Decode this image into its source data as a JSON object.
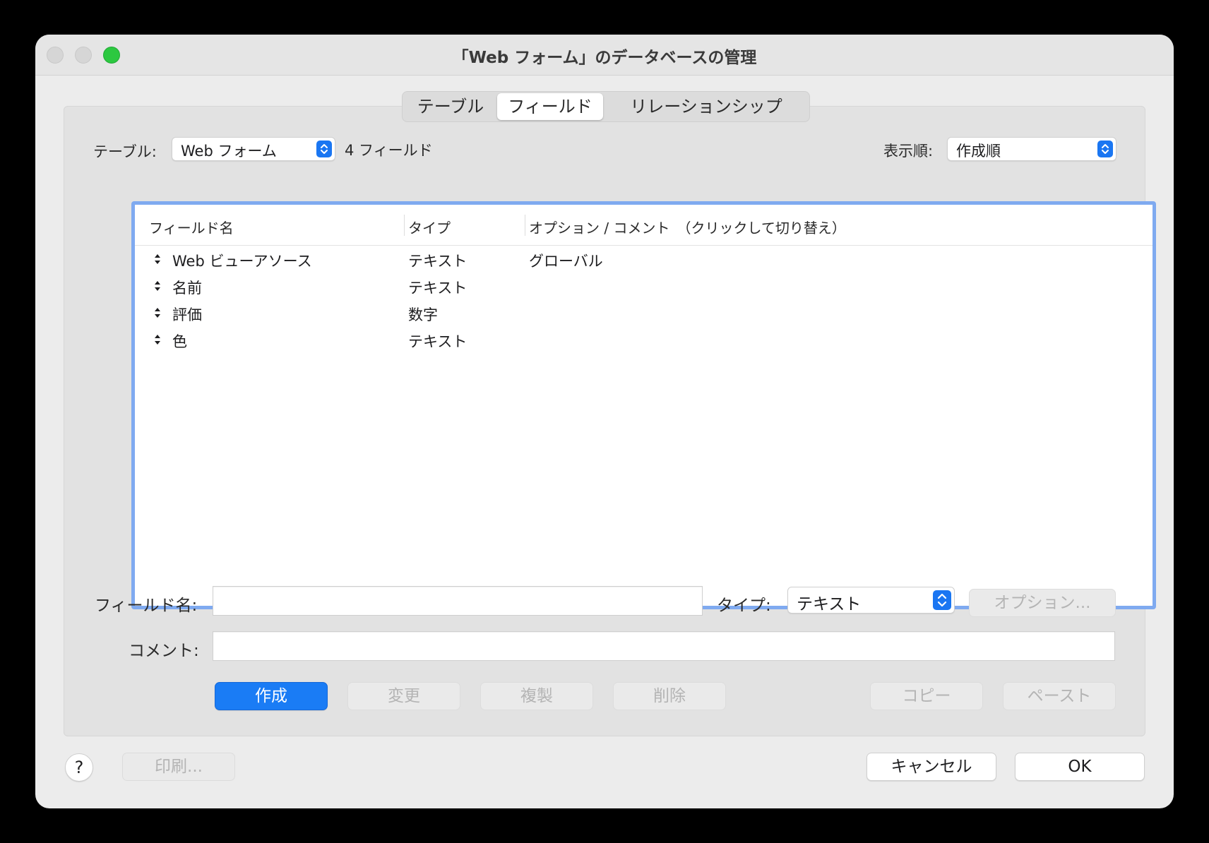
{
  "window": {
    "title": "「Web フォーム」のデータベースの管理"
  },
  "tabs": [
    {
      "label": "テーブル",
      "selected": false
    },
    {
      "label": "フィールド",
      "selected": true
    },
    {
      "label": "リレーションシップ",
      "selected": false
    }
  ],
  "toolbar": {
    "table_label": "テーブル:",
    "table_value": "Web フォーム",
    "field_count": "4 フィールド",
    "sort_label": "表示順:",
    "sort_value": "作成順"
  },
  "columns": {
    "name": "フィールド名",
    "type": "タイプ",
    "options": "オプション / コメント　（クリックして切り替え）"
  },
  "fields": [
    {
      "name": "Web ビューアソース",
      "type": "テキスト",
      "options": "グローバル"
    },
    {
      "name": "名前",
      "type": "テキスト",
      "options": ""
    },
    {
      "name": "評価",
      "type": "数字",
      "options": ""
    },
    {
      "name": "色",
      "type": "テキスト",
      "options": ""
    }
  ],
  "form": {
    "field_name_label": "フィールド名:",
    "field_name_value": "",
    "type_label": "タイプ:",
    "type_value": "テキスト",
    "options_button": "オプション...",
    "comment_label": "コメント:",
    "comment_value": ""
  },
  "actions": {
    "create": "作成",
    "change": "変更",
    "duplicate": "複製",
    "delete": "削除",
    "copy": "コピー",
    "paste": "ペースト"
  },
  "footer": {
    "help": "?",
    "print": "印刷...",
    "cancel": "キャンセル",
    "ok": "OK"
  },
  "colors": {
    "accent": "#1a7cf5",
    "focus_ring": "#7faaf0",
    "zoom_light": "#2cc840"
  }
}
